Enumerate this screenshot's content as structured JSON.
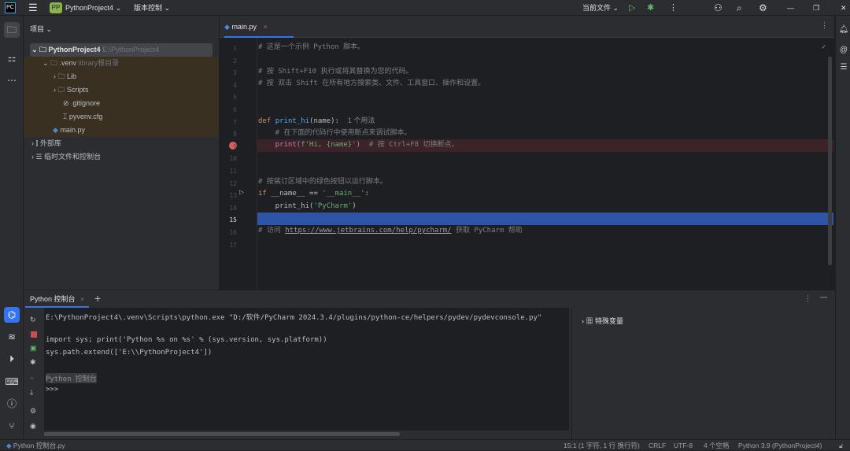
{
  "titlebar": {
    "project_badge": "PP",
    "project_name": "PythonProject4",
    "vcs": "版本控制",
    "run_config": "当前文件",
    "icons": [
      "menu-icon",
      "run-icon",
      "debug-icon",
      "more-icon",
      "add-user-icon",
      "search-icon",
      "settings-icon",
      "minimize-icon",
      "restore-icon",
      "close-icon"
    ]
  },
  "project": {
    "title": "项目",
    "items": [
      {
        "label": "PythonProject4",
        "hint": "E:\\PythonProject4"
      },
      {
        "label": ".venv",
        "hint": "library根目录"
      },
      {
        "label": "Lib"
      },
      {
        "label": "Scripts"
      },
      {
        "label": ".gitignore"
      },
      {
        "label": "pyvenv.cfg"
      },
      {
        "label": "main.py"
      },
      {
        "label": "外部库"
      },
      {
        "label": "临时文件和控制台"
      }
    ]
  },
  "editor": {
    "tab": "main.py",
    "current_line": 15,
    "breakpoint_line": 9,
    "run_gutter_line": 13,
    "lines": [
      {
        "n": "1"
      },
      {
        "n": "2"
      },
      {
        "n": "3"
      },
      {
        "n": "4"
      },
      {
        "n": "5"
      },
      {
        "n": "6"
      },
      {
        "n": "7"
      },
      {
        "n": "8"
      },
      {
        "n": "9"
      },
      {
        "n": "10"
      },
      {
        "n": "11"
      },
      {
        "n": "12"
      },
      {
        "n": "13"
      },
      {
        "n": "14"
      },
      {
        "n": "15"
      },
      {
        "n": "16"
      },
      {
        "n": "17"
      }
    ],
    "code": {
      "l1": "# 这是一个示例 Python 脚本。",
      "l3": "# 按 Shift+F10 执行或将其替换为您的代码。",
      "l4": "# 按 双击 Shift 在所有地方搜索类、文件、工具窗口、操作和设置。",
      "l7_def": "def ",
      "l7_fn": "print_hi",
      "l7_rest": "(name):",
      "l7_hint": "1 个用法",
      "l8": "    # 在下面的代码行中使用断点来调试脚本。",
      "l9_a": "    print(",
      "l9_b": "f'Hi, {name}'",
      "l9_c": ")  ",
      "l9_d": "# 按 Ctrl+F8 切换断点。",
      "l12": "# 按装订区域中的绿色按钮以运行脚本。",
      "l13_if": "if ",
      "l13_a": "__name__ == ",
      "l13_s": "'__main__'",
      "l13_b": ":",
      "l14_a": "    print_hi(",
      "l14_s": "'PyCharm'",
      "l14_b": ")",
      "l16_a": "# 访问 ",
      "l16_link": "https://www.jetbrains.com/help/pycharm/",
      "l16_b": " 获取 PyCharm 帮助"
    }
  },
  "console": {
    "tab": "Python 控制台",
    "lines": [
      "E:\\PythonProject4\\.venv\\Scripts\\python.exe \"D:/软件/PyCharm 2024.3.4/plugins/python-ce/helpers/pydev/pydevconsole.py\"",
      "import sys; print('Python %s on %s' % (sys.version, sys.platform))",
      "sys.path.extend(['E:\\\\PythonProject4'])",
      "Python 控制台",
      ">>>"
    ],
    "variables": "特殊变量"
  },
  "status": {
    "file": "Python 控制台.py",
    "position": "15:1 (1 字符, 1 行 换行符)",
    "line_sep": "CRLF",
    "encoding": "UTF-8",
    "indent": "4 个空格",
    "interpreter": "Python 3.9 (PythonProject4)"
  },
  "colors": {
    "accent": "#2e55a5",
    "breakpoint": "#db5c5c",
    "run": "#5fb865",
    "breakpoint_line_bg": "#3b2327",
    "venv_bg": "#3a3021"
  }
}
